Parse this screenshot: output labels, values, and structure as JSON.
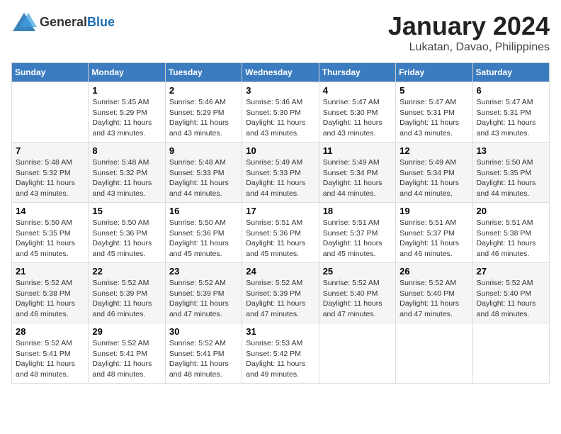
{
  "header": {
    "logo_general": "General",
    "logo_blue": "Blue",
    "title": "January 2024",
    "location": "Lukatan, Davao, Philippines"
  },
  "days_of_week": [
    "Sunday",
    "Monday",
    "Tuesday",
    "Wednesday",
    "Thursday",
    "Friday",
    "Saturday"
  ],
  "weeks": [
    [
      {
        "day": "",
        "sunrise": "",
        "sunset": "",
        "daylight": ""
      },
      {
        "day": "1",
        "sunrise": "Sunrise: 5:45 AM",
        "sunset": "Sunset: 5:29 PM",
        "daylight": "Daylight: 11 hours and 43 minutes."
      },
      {
        "day": "2",
        "sunrise": "Sunrise: 5:46 AM",
        "sunset": "Sunset: 5:29 PM",
        "daylight": "Daylight: 11 hours and 43 minutes."
      },
      {
        "day": "3",
        "sunrise": "Sunrise: 5:46 AM",
        "sunset": "Sunset: 5:30 PM",
        "daylight": "Daylight: 11 hours and 43 minutes."
      },
      {
        "day": "4",
        "sunrise": "Sunrise: 5:47 AM",
        "sunset": "Sunset: 5:30 PM",
        "daylight": "Daylight: 11 hours and 43 minutes."
      },
      {
        "day": "5",
        "sunrise": "Sunrise: 5:47 AM",
        "sunset": "Sunset: 5:31 PM",
        "daylight": "Daylight: 11 hours and 43 minutes."
      },
      {
        "day": "6",
        "sunrise": "Sunrise: 5:47 AM",
        "sunset": "Sunset: 5:31 PM",
        "daylight": "Daylight: 11 hours and 43 minutes."
      }
    ],
    [
      {
        "day": "7",
        "sunrise": "Sunrise: 5:48 AM",
        "sunset": "Sunset: 5:32 PM",
        "daylight": "Daylight: 11 hours and 43 minutes."
      },
      {
        "day": "8",
        "sunrise": "Sunrise: 5:48 AM",
        "sunset": "Sunset: 5:32 PM",
        "daylight": "Daylight: 11 hours and 43 minutes."
      },
      {
        "day": "9",
        "sunrise": "Sunrise: 5:48 AM",
        "sunset": "Sunset: 5:33 PM",
        "daylight": "Daylight: 11 hours and 44 minutes."
      },
      {
        "day": "10",
        "sunrise": "Sunrise: 5:49 AM",
        "sunset": "Sunset: 5:33 PM",
        "daylight": "Daylight: 11 hours and 44 minutes."
      },
      {
        "day": "11",
        "sunrise": "Sunrise: 5:49 AM",
        "sunset": "Sunset: 5:34 PM",
        "daylight": "Daylight: 11 hours and 44 minutes."
      },
      {
        "day": "12",
        "sunrise": "Sunrise: 5:49 AM",
        "sunset": "Sunset: 5:34 PM",
        "daylight": "Daylight: 11 hours and 44 minutes."
      },
      {
        "day": "13",
        "sunrise": "Sunrise: 5:50 AM",
        "sunset": "Sunset: 5:35 PM",
        "daylight": "Daylight: 11 hours and 44 minutes."
      }
    ],
    [
      {
        "day": "14",
        "sunrise": "Sunrise: 5:50 AM",
        "sunset": "Sunset: 5:35 PM",
        "daylight": "Daylight: 11 hours and 45 minutes."
      },
      {
        "day": "15",
        "sunrise": "Sunrise: 5:50 AM",
        "sunset": "Sunset: 5:36 PM",
        "daylight": "Daylight: 11 hours and 45 minutes."
      },
      {
        "day": "16",
        "sunrise": "Sunrise: 5:50 AM",
        "sunset": "Sunset: 5:36 PM",
        "daylight": "Daylight: 11 hours and 45 minutes."
      },
      {
        "day": "17",
        "sunrise": "Sunrise: 5:51 AM",
        "sunset": "Sunset: 5:36 PM",
        "daylight": "Daylight: 11 hours and 45 minutes."
      },
      {
        "day": "18",
        "sunrise": "Sunrise: 5:51 AM",
        "sunset": "Sunset: 5:37 PM",
        "daylight": "Daylight: 11 hours and 45 minutes."
      },
      {
        "day": "19",
        "sunrise": "Sunrise: 5:51 AM",
        "sunset": "Sunset: 5:37 PM",
        "daylight": "Daylight: 11 hours and 46 minutes."
      },
      {
        "day": "20",
        "sunrise": "Sunrise: 5:51 AM",
        "sunset": "Sunset: 5:38 PM",
        "daylight": "Daylight: 11 hours and 46 minutes."
      }
    ],
    [
      {
        "day": "21",
        "sunrise": "Sunrise: 5:52 AM",
        "sunset": "Sunset: 5:38 PM",
        "daylight": "Daylight: 11 hours and 46 minutes."
      },
      {
        "day": "22",
        "sunrise": "Sunrise: 5:52 AM",
        "sunset": "Sunset: 5:39 PM",
        "daylight": "Daylight: 11 hours and 46 minutes."
      },
      {
        "day": "23",
        "sunrise": "Sunrise: 5:52 AM",
        "sunset": "Sunset: 5:39 PM",
        "daylight": "Daylight: 11 hours and 47 minutes."
      },
      {
        "day": "24",
        "sunrise": "Sunrise: 5:52 AM",
        "sunset": "Sunset: 5:39 PM",
        "daylight": "Daylight: 11 hours and 47 minutes."
      },
      {
        "day": "25",
        "sunrise": "Sunrise: 5:52 AM",
        "sunset": "Sunset: 5:40 PM",
        "daylight": "Daylight: 11 hours and 47 minutes."
      },
      {
        "day": "26",
        "sunrise": "Sunrise: 5:52 AM",
        "sunset": "Sunset: 5:40 PM",
        "daylight": "Daylight: 11 hours and 47 minutes."
      },
      {
        "day": "27",
        "sunrise": "Sunrise: 5:52 AM",
        "sunset": "Sunset: 5:40 PM",
        "daylight": "Daylight: 11 hours and 48 minutes."
      }
    ],
    [
      {
        "day": "28",
        "sunrise": "Sunrise: 5:52 AM",
        "sunset": "Sunset: 5:41 PM",
        "daylight": "Daylight: 11 hours and 48 minutes."
      },
      {
        "day": "29",
        "sunrise": "Sunrise: 5:52 AM",
        "sunset": "Sunset: 5:41 PM",
        "daylight": "Daylight: 11 hours and 48 minutes."
      },
      {
        "day": "30",
        "sunrise": "Sunrise: 5:52 AM",
        "sunset": "Sunset: 5:41 PM",
        "daylight": "Daylight: 11 hours and 48 minutes."
      },
      {
        "day": "31",
        "sunrise": "Sunrise: 5:53 AM",
        "sunset": "Sunset: 5:42 PM",
        "daylight": "Daylight: 11 hours and 49 minutes."
      },
      {
        "day": "",
        "sunrise": "",
        "sunset": "",
        "daylight": ""
      },
      {
        "day": "",
        "sunrise": "",
        "sunset": "",
        "daylight": ""
      },
      {
        "day": "",
        "sunrise": "",
        "sunset": "",
        "daylight": ""
      }
    ]
  ]
}
